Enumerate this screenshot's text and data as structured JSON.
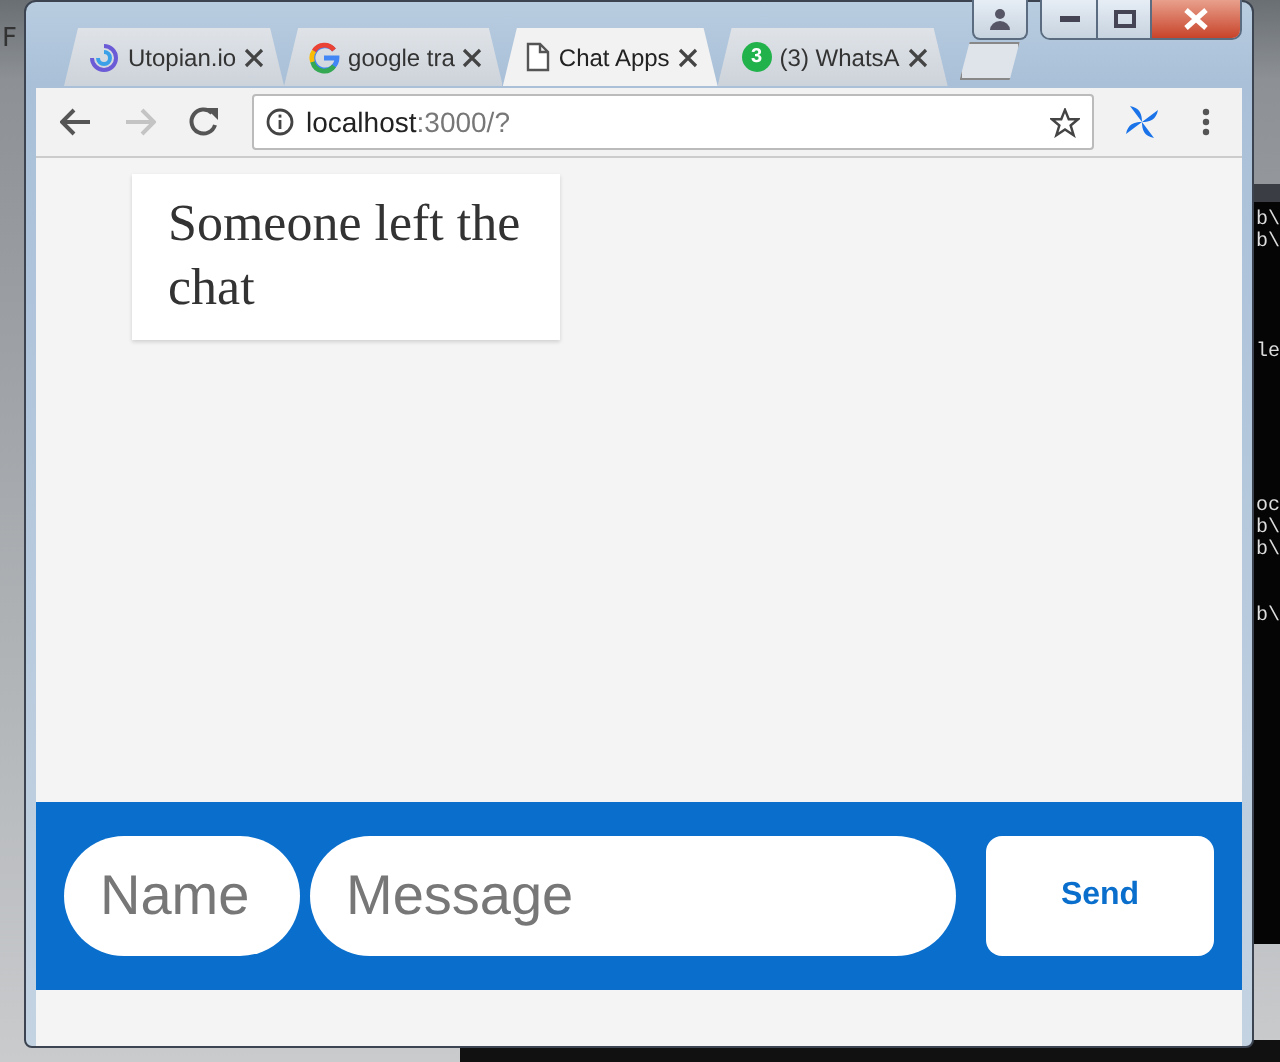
{
  "desktop": {
    "corner_text": "F",
    "terminal_lines": [
      {
        "kind": "text",
        "text": "b\\"
      },
      {
        "kind": "text",
        "text": "b\\"
      },
      {
        "kind": "blank"
      },
      {
        "kind": "blank"
      },
      {
        "kind": "blank"
      },
      {
        "kind": "blank"
      },
      {
        "kind": "text",
        "text": "le"
      },
      {
        "kind": "blank"
      },
      {
        "kind": "blank"
      },
      {
        "kind": "blank"
      },
      {
        "kind": "blank"
      },
      {
        "kind": "blank"
      },
      {
        "kind": "blank"
      },
      {
        "kind": "text",
        "text": "oc"
      },
      {
        "kind": "text",
        "text": "b\\"
      },
      {
        "kind": "text",
        "text": "b\\"
      },
      {
        "kind": "blank"
      },
      {
        "kind": "blank"
      },
      {
        "kind": "text",
        "text": "b\\"
      }
    ]
  },
  "tabs": [
    {
      "title": "Utopian.io",
      "kind": "swirl",
      "selected": false
    },
    {
      "title": "google tra",
      "kind": "google",
      "selected": false
    },
    {
      "title": "Chat Apps",
      "kind": "page",
      "selected": true
    },
    {
      "title": "(3) WhatsA",
      "kind": "bubble",
      "badge": "3",
      "selected": false
    }
  ],
  "toolbar": {
    "forward_disabled": true,
    "address": {
      "host": "localhost",
      "rest": ":3000/?"
    }
  },
  "chat": {
    "messages": [
      {
        "text": "Someone left the chat"
      }
    ],
    "composer": {
      "name_placeholder": "Name",
      "message_placeholder": "Message",
      "send_label": "Send"
    }
  }
}
